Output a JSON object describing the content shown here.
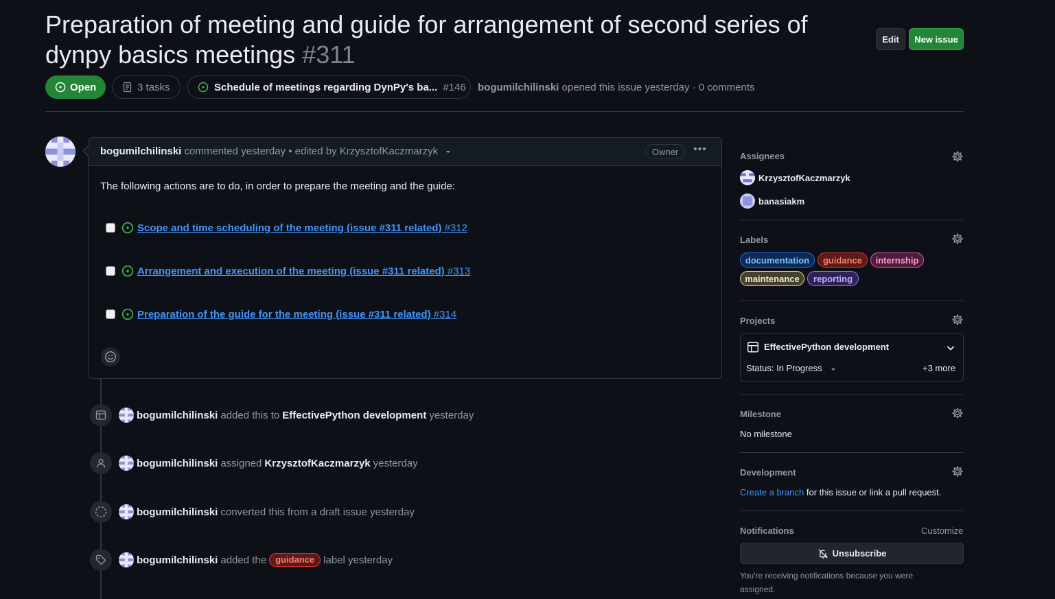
{
  "issue": {
    "title": "Preparation of meeting and guide for arrangement of second series of dynpy basics meetings",
    "number": "#311",
    "state": "Open",
    "tasks_label": "3 tasks",
    "parent_title": "Schedule of meetings regarding DynPy's ba...",
    "parent_number": "#146",
    "author": "bogumilchilinski",
    "opened_text": "opened this issue yesterday · 0 comments"
  },
  "header_buttons": {
    "edit": "Edit",
    "new_issue": "New issue"
  },
  "comment": {
    "author": "bogumilchilinski",
    "meta": "commented yesterday • edited by KrzysztofKaczmarzyk",
    "badge": "Owner",
    "body": "The following actions are to do, in order to prepare the meeting and the guide:",
    "tasks": [
      {
        "title": "Scope and time scheduling of the meeting (issue #311 related)",
        "number": "#312"
      },
      {
        "title": "Arrangement and execution of the meeting (issue #311 related)",
        "number": "#313"
      },
      {
        "title": "Preparation of the guide for the meeting (issue #311 related)",
        "number": "#314"
      }
    ]
  },
  "timeline": [
    {
      "icon": "table-icon",
      "actor": "bogumilchilinski",
      "pre": "added this to",
      "target": "EffectivePython development",
      "post": "yesterday"
    },
    {
      "icon": "person-icon",
      "actor": "bogumilchilinski",
      "pre": "assigned",
      "target": "KrzysztofKaczmarzyk",
      "post": "yesterday"
    },
    {
      "icon": "dashed-circle-icon",
      "actor": "bogumilchilinski",
      "pre": "converted this from a draft issue yesterday"
    },
    {
      "icon": "tag-icon",
      "actor": "bogumilchilinski",
      "pre": "added the",
      "label": "guidance",
      "post": "label yesterday"
    }
  ],
  "sidebar": {
    "assignees_title": "Assignees",
    "assignees": [
      "KrzysztofKaczmarzyk",
      "banasiakm"
    ],
    "labels_title": "Labels",
    "labels": [
      {
        "name": "documentation",
        "color": "#1f6feb"
      },
      {
        "name": "guidance",
        "color": "#da3633"
      },
      {
        "name": "internship",
        "color": "#db61a2"
      },
      {
        "name": "maintenance",
        "color": "#e3d9a2"
      },
      {
        "name": "reporting",
        "color": "#a371f7"
      }
    ],
    "projects_title": "Projects",
    "project_name": "EffectivePython development",
    "project_status": "Status: In Progress",
    "project_more": "+3 more",
    "milestone_title": "Milestone",
    "milestone_value": "No milestone",
    "development_title": "Development",
    "development_link": "Create a branch",
    "development_text": " for this issue or link a pull request.",
    "notifications_title": "Notifications",
    "customize": "Customize",
    "unsubscribe": "Unsubscribe",
    "notification_reason": "You're receiving notifications because you were assigned."
  }
}
